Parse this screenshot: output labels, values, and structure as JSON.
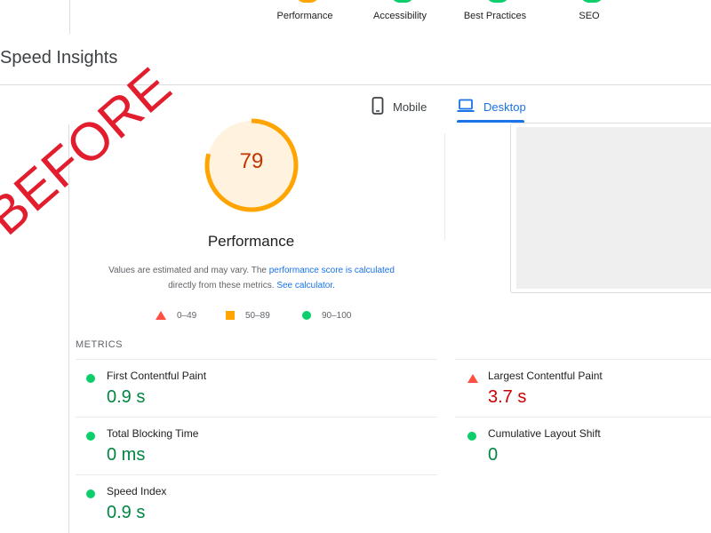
{
  "top": {
    "categories": [
      {
        "label": "Performance",
        "color": "#ffa400"
      },
      {
        "label": "Accessibility",
        "color": "#0cce6b"
      },
      {
        "label": "Best Practices",
        "color": "#0cce6b"
      },
      {
        "label": "SEO",
        "color": "#0cce6b"
      }
    ]
  },
  "header": {
    "title": "Speed Insights"
  },
  "tabs": {
    "mobile": {
      "label": "Mobile",
      "icon": "smartphone-icon"
    },
    "desktop": {
      "label": "Desktop",
      "icon": "laptop-icon",
      "selected": true
    }
  },
  "report": {
    "score": "79",
    "score_fraction": 0.79,
    "score_color": "#ffa400",
    "title": "Performance",
    "desc_text_1": "Values are estimated and may vary. The ",
    "desc_link_1": "performance score is calculated",
    "desc_text_2": "directly from these metrics. ",
    "desc_link_2": "See calculator."
  },
  "legend": [
    {
      "icon": "red-triangle-icon",
      "label": "0–49"
    },
    {
      "icon": "orange-square-icon",
      "label": "50–89"
    },
    {
      "icon": "green-circle-icon",
      "label": "90–100"
    }
  ],
  "metrics": {
    "heading": "METRICS",
    "fcp": {
      "label": "First Contentful Paint",
      "value": "0.9 s",
      "status": "good"
    },
    "lcp": {
      "label": "Largest Contentful Paint",
      "value": "3.7 s",
      "status": "poor"
    },
    "tbt": {
      "label": "Total Blocking Time",
      "value": "0 ms",
      "status": "good"
    },
    "cls": {
      "label": "Cumulative Layout Shift",
      "value": "0",
      "status": "good"
    },
    "si": {
      "label": "Speed Index",
      "value": "0.9 s",
      "status": "good"
    }
  },
  "overlay": {
    "stamp_text": "BEFORE",
    "stamp_color": "#e11d2e"
  },
  "colors": {
    "accent": "#1a73e8",
    "good": "#018642",
    "poor": "#cc0000",
    "average": "#ffa400"
  }
}
